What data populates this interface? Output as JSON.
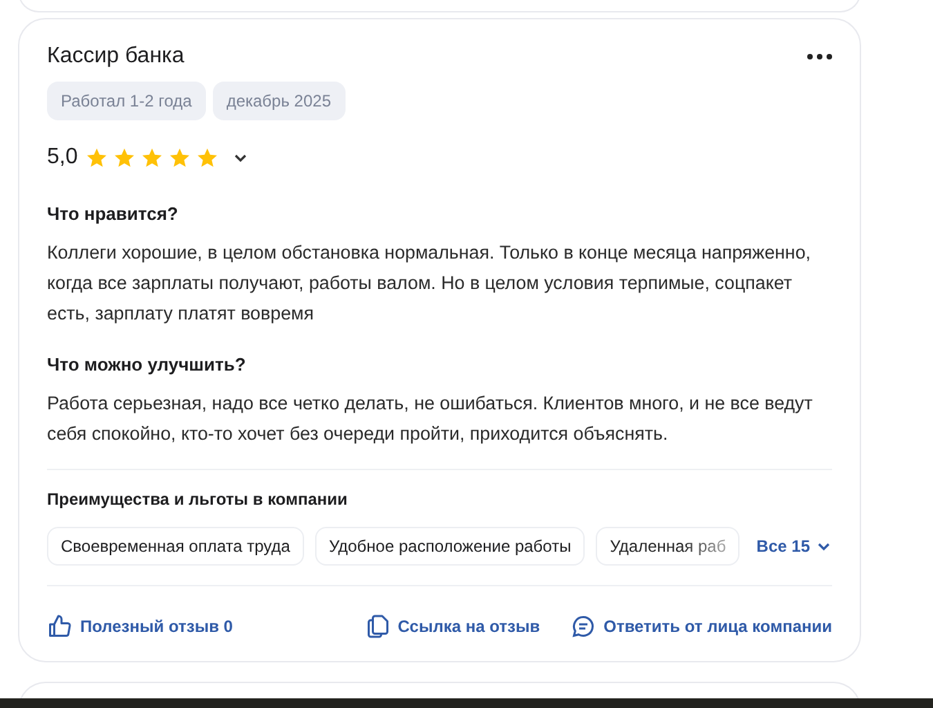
{
  "review": {
    "title": "Кассир банка",
    "tags": [
      "Работал 1-2 года",
      "декабрь 2025"
    ],
    "rating": "5,0",
    "stars": 5,
    "sections": [
      {
        "heading": "Что нравится?",
        "text": "Коллеги хорошие, в целом обстановка нормальная. Только в конце месяца напряженно, когда все зарплаты получают, работы валом. Но в целом условия терпимые, соцпакет есть, зарплату платят вовремя"
      },
      {
        "heading": "Что можно улучшить?",
        "text": "Работа серьезная, надо все четко делать, не ошибаться. Клиентов много, и не все ведут себя спокойно, кто-то хочет без очереди пройти, приходится объяснять."
      }
    ],
    "benefits_heading": "Преимущества и льготы в компании",
    "benefits": [
      "Своевременная оплата труда",
      "Удобное расположение работы",
      "Удаленная раб"
    ],
    "benefits_more": "Все 15",
    "actions": [
      {
        "kind": "like",
        "label": "Полезный отзыв 0"
      },
      {
        "kind": "copy",
        "label": "Ссылка на отзыв"
      },
      {
        "kind": "reply",
        "label": "Ответить от лица компании"
      }
    ]
  }
}
